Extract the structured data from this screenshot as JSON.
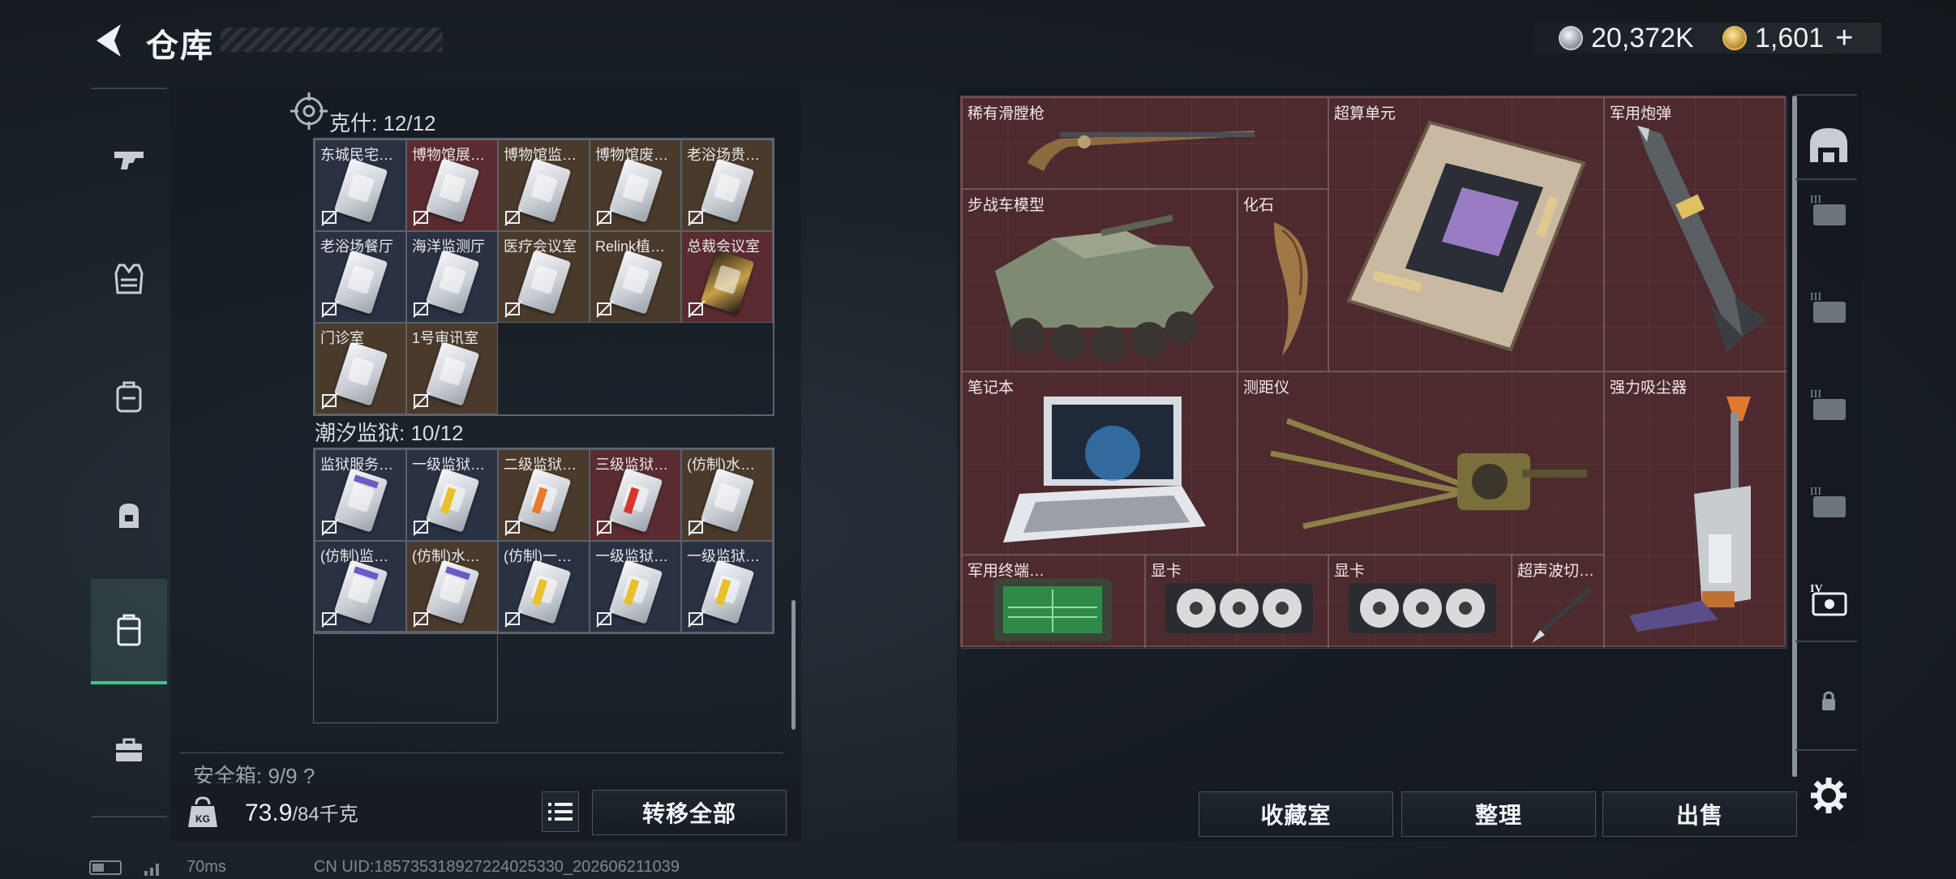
{
  "header": {
    "title": "仓库",
    "currency_silver": "20,372K",
    "currency_gold": "1,601",
    "add_label": "+"
  },
  "left_nav": {
    "items": [
      {
        "name": "weapons",
        "icon": "pistol-icon"
      },
      {
        "name": "armor",
        "icon": "vest-icon"
      },
      {
        "name": "backpack",
        "icon": "backpack-icon"
      },
      {
        "name": "gear",
        "icon": "pouch-icon"
      },
      {
        "name": "keys",
        "icon": "keycard-case-icon",
        "active": true
      },
      {
        "name": "toolbox",
        "icon": "toolbox-icon"
      }
    ]
  },
  "key_groups": [
    {
      "title": "克什: 12/12",
      "cells": [
        {
          "label": "东城民宅…",
          "bg": "dark"
        },
        {
          "label": "博物馆展…",
          "bg": "red"
        },
        {
          "label": "博物馆监…",
          "bg": "brown"
        },
        {
          "label": "博物馆废…",
          "bg": "brown"
        },
        {
          "label": "老浴场贵…",
          "bg": "brown"
        },
        {
          "label": "老浴场餐厅",
          "bg": "dark"
        },
        {
          "label": "海洋监测厅",
          "bg": "dark"
        },
        {
          "label": "医疗会议室",
          "bg": "brown"
        },
        {
          "label": "Relink植…",
          "bg": "brown"
        },
        {
          "label": "总裁会议室",
          "bg": "red",
          "card": "gold"
        },
        {
          "label": "门诊室",
          "bg": "brown"
        },
        {
          "label": "1号审讯室",
          "bg": "brown"
        }
      ]
    },
    {
      "title": "潮汐监狱: 10/12",
      "cells": [
        {
          "label": "监狱服务…",
          "bg": "dark",
          "card": "purple"
        },
        {
          "label": "一级监狱…",
          "bg": "dark",
          "card": "yellow"
        },
        {
          "label": "二级监狱…",
          "bg": "brown",
          "card": "orange"
        },
        {
          "label": "三级监狱…",
          "bg": "red",
          "card": "redtag"
        },
        {
          "label": "(仿制)水…",
          "bg": "brown"
        },
        {
          "label": "(仿制)监…",
          "bg": "dark",
          "card": "purple"
        },
        {
          "label": "(仿制)水…",
          "bg": "brown",
          "card": "purple"
        },
        {
          "label": "(仿制)一…",
          "bg": "dark",
          "card": "yellow"
        },
        {
          "label": "一级监狱…",
          "bg": "dark",
          "card": "yellow"
        },
        {
          "label": "一级监狱…",
          "bg": "dark",
          "card": "yellow"
        }
      ]
    }
  ],
  "safebox": {
    "label": "安全箱: 9/9 ?"
  },
  "weight": {
    "current": "73.9",
    "capacity": "/84千克",
    "icon_label": "KG"
  },
  "buttons": {
    "transfer_all": "转移全部",
    "collection": "收藏室",
    "organize": "整理",
    "sell": "出售"
  },
  "stash_items": [
    {
      "name": "稀有滑膛枪",
      "icon": "musket-icon"
    },
    {
      "name": "超算单元",
      "icon": "supercomputer-board-icon"
    },
    {
      "name": "军用炮弹",
      "icon": "artillery-shell-icon"
    },
    {
      "name": "步战车模型",
      "icon": "ifv-model-icon"
    },
    {
      "name": "化石",
      "icon": "fossil-claw-icon"
    },
    {
      "name": "笔记本",
      "icon": "laptop-icon"
    },
    {
      "name": "测距仪",
      "icon": "rangefinder-icon"
    },
    {
      "name": "强力吸尘器",
      "icon": "vacuum-icon"
    },
    {
      "name": "军用终端…",
      "icon": "tablet-icon"
    },
    {
      "name": "显卡",
      "icon": "gpu-icon"
    },
    {
      "name": "显卡",
      "icon": "gpu-icon"
    },
    {
      "name": "超声波切…",
      "icon": "scalpel-icon"
    }
  ],
  "status": {
    "ping": "70ms",
    "uid": "CN UID:18573531892722402533​0_202606211039"
  },
  "colors": {
    "accent_green": "#3ec58a",
    "stash_bg": "#4d2a2e"
  }
}
